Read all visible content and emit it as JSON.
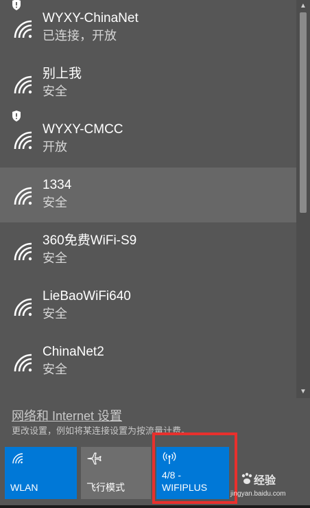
{
  "networks": [
    {
      "name": "WYXY-ChinaNet",
      "status": "已连接，开放",
      "secured": false,
      "open_shield": true,
      "highlight": false
    },
    {
      "name": "别上我",
      "status": "安全",
      "secured": true,
      "open_shield": false,
      "highlight": false
    },
    {
      "name": "WYXY-CMCC",
      "status": "开放",
      "secured": false,
      "open_shield": true,
      "highlight": false
    },
    {
      "name": "1334",
      "status": "安全",
      "secured": true,
      "open_shield": false,
      "highlight": true
    },
    {
      "name": "360免费WiFi-S9",
      "status": "安全",
      "secured": true,
      "open_shield": false,
      "highlight": false
    },
    {
      "name": "LieBaoWiFi640",
      "status": "安全",
      "secured": true,
      "open_shield": false,
      "highlight": false
    },
    {
      "name": "ChinaNet2",
      "status": "安全",
      "secured": true,
      "open_shield": false,
      "highlight": false
    }
  ],
  "settings": {
    "link": "网络和 Internet 设置",
    "description": "更改设置，例如将某连接设置为按流量计费。"
  },
  "quick_actions": {
    "wlan": {
      "label": "WLAN",
      "icon": "wifi-icon",
      "active": true
    },
    "airplane": {
      "label": "飞行模式",
      "icon": "airplane-icon",
      "active": false
    },
    "hotspot": {
      "label_line1": "4/8 -",
      "label_line2": "WIFIPLUS",
      "icon": "hotspot-icon",
      "active": true
    }
  },
  "watermark": {
    "brand": "经验",
    "url": "jingyan.baidu.com"
  },
  "colors": {
    "accent": "#0078d7",
    "highlight_box": "#e8302d",
    "panel": "#565656"
  }
}
